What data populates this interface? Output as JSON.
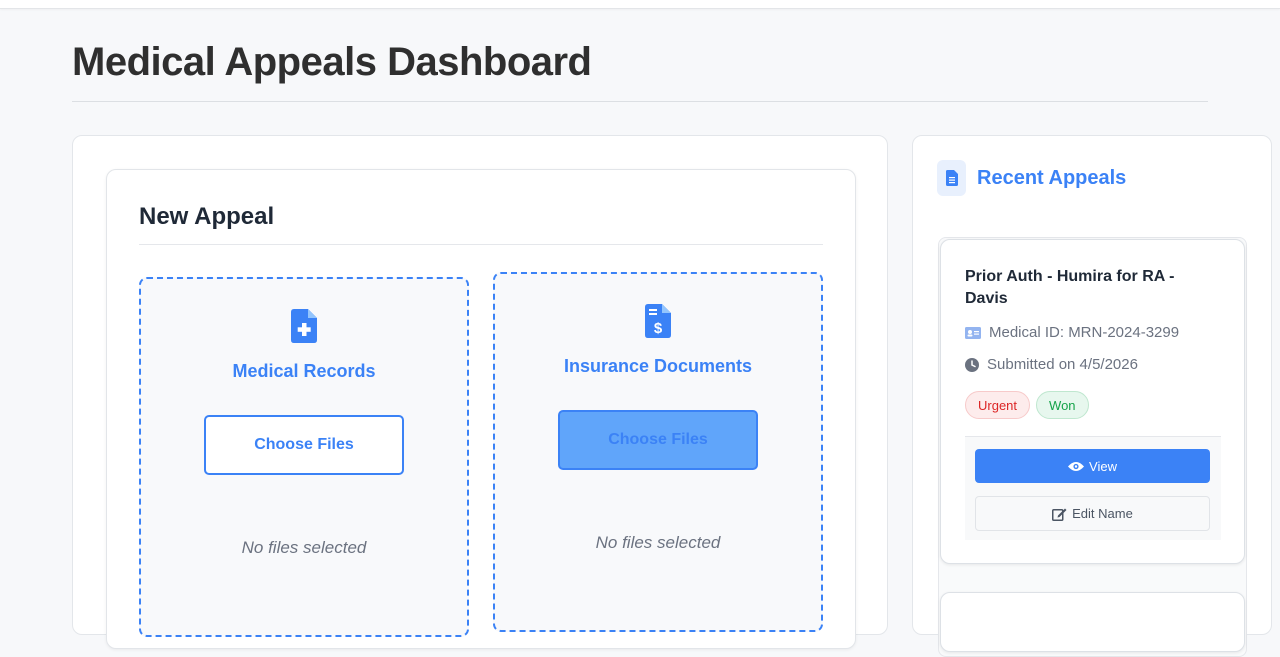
{
  "header": {
    "title": "Medical Appeals Dashboard"
  },
  "new_appeal": {
    "title": "New Appeal",
    "uploads": [
      {
        "label": "Medical Records",
        "button": "Choose Files",
        "status": "No files selected",
        "icon": "file-medical-icon"
      },
      {
        "label": "Insurance Documents",
        "button": "Choose Files",
        "status": "No files selected",
        "icon": "file-invoice-dollar-icon"
      }
    ]
  },
  "recent_appeals": {
    "title": "Recent Appeals",
    "icon": "file-icon",
    "items": [
      {
        "title": "Prior Auth - Humira for RA - Davis",
        "medical_id": "Medical ID: MRN-2024-3299",
        "submitted": "Submitted on 4/5/2026",
        "badges": [
          "Urgent",
          "Won"
        ],
        "view_label": "View",
        "edit_label": "Edit Name"
      }
    ]
  },
  "colors": {
    "accent": "#3b82f6",
    "urgent": "#dc2626",
    "won": "#16a34a"
  }
}
